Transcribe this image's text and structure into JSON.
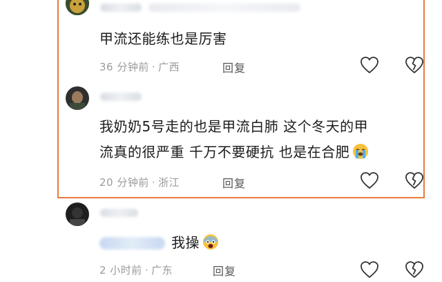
{
  "comments": [
    {
      "text": "甲流还能练也是厉害",
      "time": "36 分钟前",
      "location": "广西",
      "reply_label": "回复"
    },
    {
      "text_line1": "我奶奶5号走的也是甲流白肺 这个冬天的甲",
      "text_line2": "流真的很严重 千万不要硬抗 也是在合肥",
      "time": "20 分钟前",
      "location": "浙江",
      "reply_label": "回复"
    },
    {
      "text": "我操",
      "time": "2 小时前",
      "location": "广东",
      "reply_label": "回复"
    }
  ],
  "meta_separator": "·",
  "colors": {
    "highlight_border": "#e8793d",
    "meta_text": "#9a9a9a"
  },
  "icons": [
    "avatar",
    "like-heart-icon",
    "broken-heart-icon",
    "crying-emoji-icon",
    "shocked-emoji-icon"
  ]
}
